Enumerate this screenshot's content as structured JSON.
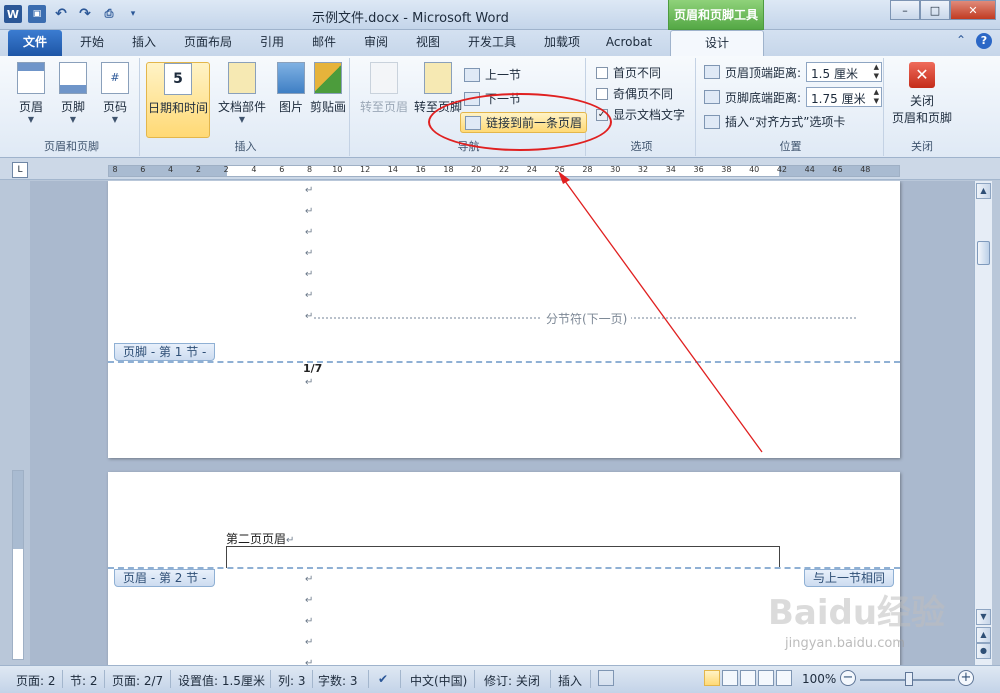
{
  "window": {
    "title": "示例文件.docx - Microsoft Word",
    "context_tab_header": "页眉和页脚工具",
    "controls": {
      "minimize": "–",
      "maximize": "□",
      "close": "✕"
    }
  },
  "qat": {
    "app_icon": "W"
  },
  "tabs": [
    {
      "label": "文件"
    },
    {
      "label": "开始"
    },
    {
      "label": "插入"
    },
    {
      "label": "页面布局"
    },
    {
      "label": "引用"
    },
    {
      "label": "邮件"
    },
    {
      "label": "审阅"
    },
    {
      "label": "视图"
    },
    {
      "label": "开发工具"
    },
    {
      "label": "加载项"
    },
    {
      "label": "Acrobat"
    },
    {
      "label": "设计"
    }
  ],
  "ribbon": {
    "group_header_footer": {
      "label": "页眉和页脚",
      "header_btn": "页眉",
      "footer_btn": "页脚",
      "page_number_btn": "页码"
    },
    "group_insert": {
      "label": "插入",
      "datetime_btn": "日期和时间",
      "docparts_btn": "文档部件",
      "picture_btn": "图片",
      "clipart_btn": "剪贴画"
    },
    "group_nav": {
      "label": "导航",
      "goto_header": "转至页眉",
      "goto_footer": "转至页脚",
      "prev_section": "上一节",
      "next_section": "下一节",
      "link_prev": "链接到前一条页眉"
    },
    "group_options": {
      "label": "选项",
      "diff_first": "首页不同",
      "diff_oddeven": "奇偶页不同",
      "show_doc_text": "显示文档文字"
    },
    "group_position": {
      "label": "位置",
      "header_top_label": "页眉顶端距离:",
      "header_top_value": "1.5 厘米",
      "footer_bottom_label": "页脚底端距离:",
      "footer_bottom_value": "1.75 厘米",
      "insert_align_tab": "插入“对齐方式”选项卡"
    },
    "group_close": {
      "label": "关闭",
      "close_btn_line1": "关闭",
      "close_btn_line2": "页眉和页脚"
    }
  },
  "ruler": {
    "ticks": [
      "8",
      "6",
      "4",
      "2",
      "2",
      "4",
      "6",
      "8",
      "10",
      "12",
      "14",
      "16",
      "18",
      "20",
      "22",
      "24",
      "26",
      "28",
      "30",
      "32",
      "34",
      "36",
      "38",
      "40",
      "42",
      "44",
      "46",
      "48"
    ]
  },
  "document": {
    "paragraph_mark": "↵",
    "section_break_label": "分节符(下一页)",
    "footer_tag_1": "页脚 - 第 1 节 -",
    "page_number_text": "1/7",
    "header_text_page2": "第二页页眉",
    "header_tag_2": "页眉 - 第 2 节 -",
    "same_as_previous": "与上一节相同"
  },
  "statusbar": {
    "page": "页面: 2",
    "section": "节: 2",
    "page_of": "页面: 2/7",
    "setting": "设置值: 1.5厘米",
    "column": "列: 3",
    "word_count": "字数: 3",
    "language": "中文(中国)",
    "track_changes": "修订: 关闭",
    "insert_mode": "插入",
    "zoom": "100%"
  },
  "watermark": {
    "brand": "Baidu经验",
    "url": "jingyan.baidu.com"
  },
  "colors": {
    "accent": "#2b5797",
    "context_green": "#54a845",
    "annotation_red": "#e02020"
  }
}
